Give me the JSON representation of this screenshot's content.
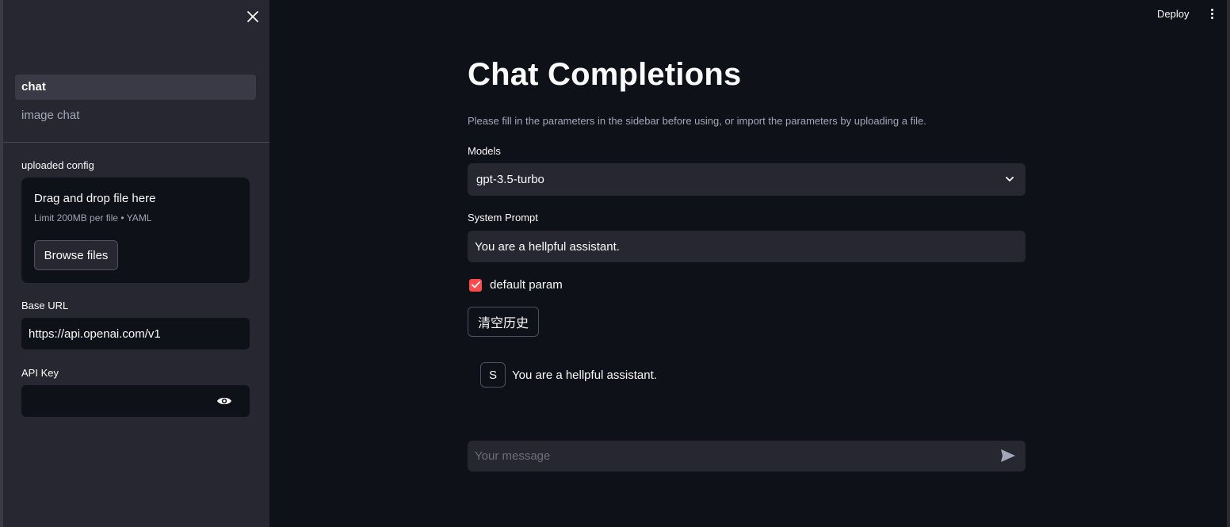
{
  "sidebar": {
    "nav": [
      {
        "label": "chat",
        "active": true
      },
      {
        "label": "image chat",
        "active": false
      }
    ],
    "upload": {
      "label": "uploaded config",
      "dropzone_title": "Drag and drop file here",
      "dropzone_limit": "Limit 200MB per file • YAML",
      "browse_label": "Browse files"
    },
    "base_url": {
      "label": "Base URL",
      "value": "https://api.openai.com/v1"
    },
    "api_key": {
      "label": "API Key",
      "value": ""
    }
  },
  "header": {
    "deploy_label": "Deploy"
  },
  "main": {
    "title": "Chat Completions",
    "caption": "Please fill in the parameters in the sidebar before using, or import the parameters by uploading a file.",
    "models": {
      "label": "Models",
      "selected": "gpt-3.5-turbo"
    },
    "system_prompt": {
      "label": "System Prompt",
      "value": "You are a hellpful assistant."
    },
    "default_param": {
      "label": "default param",
      "checked": true
    },
    "clear_history_label": "清空历史",
    "messages": [
      {
        "avatar": "S",
        "text": "You are a hellpful assistant."
      }
    ],
    "chat_input": {
      "placeholder": "Your message"
    }
  },
  "colors": {
    "background": "#0e1117",
    "sidebar": "#262730",
    "accent": "#ff4b4b"
  }
}
